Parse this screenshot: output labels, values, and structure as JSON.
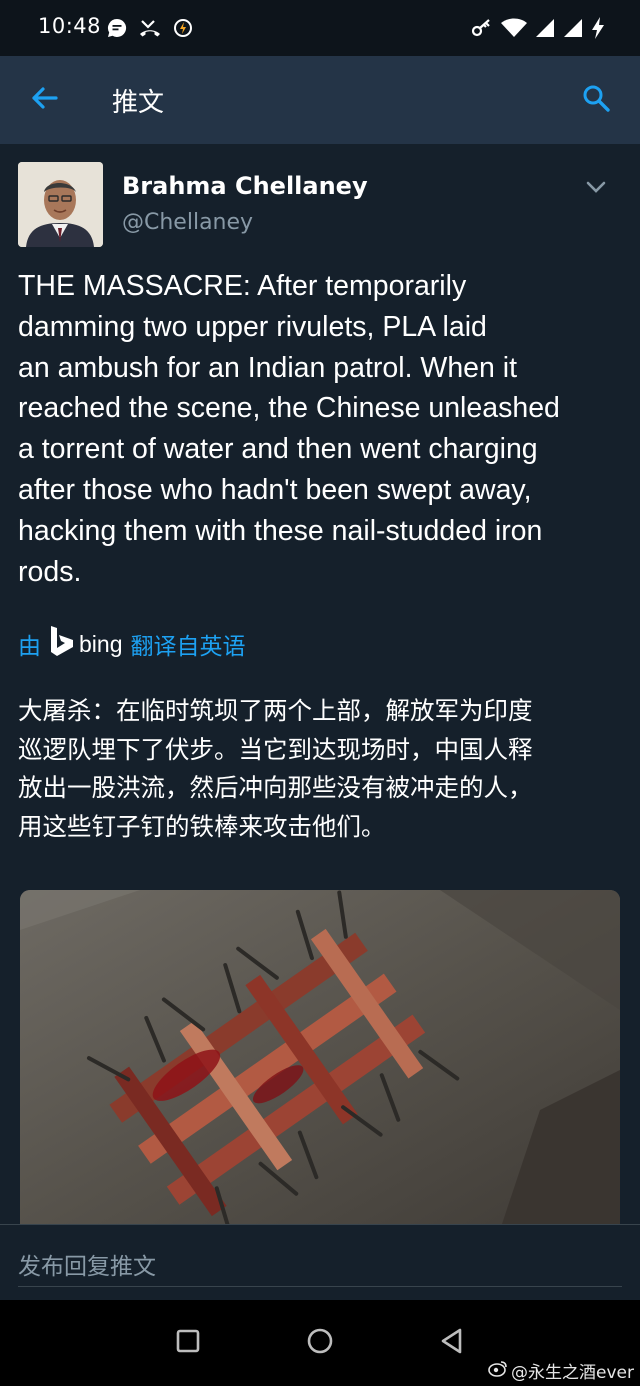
{
  "status_bar": {
    "time": "10:48",
    "left_icons": [
      "chat-bubble-icon",
      "missed-call-icon",
      "data-saver-icon"
    ],
    "right_icons": [
      "vpn-key-icon",
      "wifi-icon",
      "signal-icon",
      "signal-icon",
      "battery-charging-icon"
    ]
  },
  "app_bar": {
    "title": "推文",
    "back_icon": "arrow-left-icon",
    "search_icon": "search-icon",
    "accent_color": "#1da1f2"
  },
  "tweet": {
    "author_name": "Brahma Chellaney",
    "author_handle": "@Chellaney",
    "text_lines": [
      "THE MASSACRE: After temporarily",
      "damming two upper rivulets, PLA laid",
      "an ambush for an Indian patrol. When it",
      "reached the scene, the Chinese unleashed",
      "a torrent of water and then went charging",
      "after those who hadn't been swept away,",
      "hacking them with these nail-studded iron",
      "rods."
    ],
    "translation": {
      "prefix": "由",
      "provider": "bing",
      "link_label": "翻译自英语"
    },
    "translated_lines": [
      "大屠杀：在临时筑坝了两个上部，解放军为印度",
      "巡逻队埋下了伏步。当它到达现场时，中国人释",
      "放出一股洪流，然后冲向那些没有被冲走的人，",
      "用这些钉子钉的铁棒来攻击他们。"
    ]
  },
  "reply": {
    "placeholder": "发布回复推文"
  },
  "nav_bar": {
    "buttons": [
      "recents-square-icon",
      "home-circle-icon",
      "back-triangle-icon"
    ],
    "watermark": "@永生之酒ever"
  },
  "colors": {
    "background": "#15202b",
    "app_bar": "#243447",
    "secondary_text": "#8899a6",
    "divider": "#38444d"
  }
}
